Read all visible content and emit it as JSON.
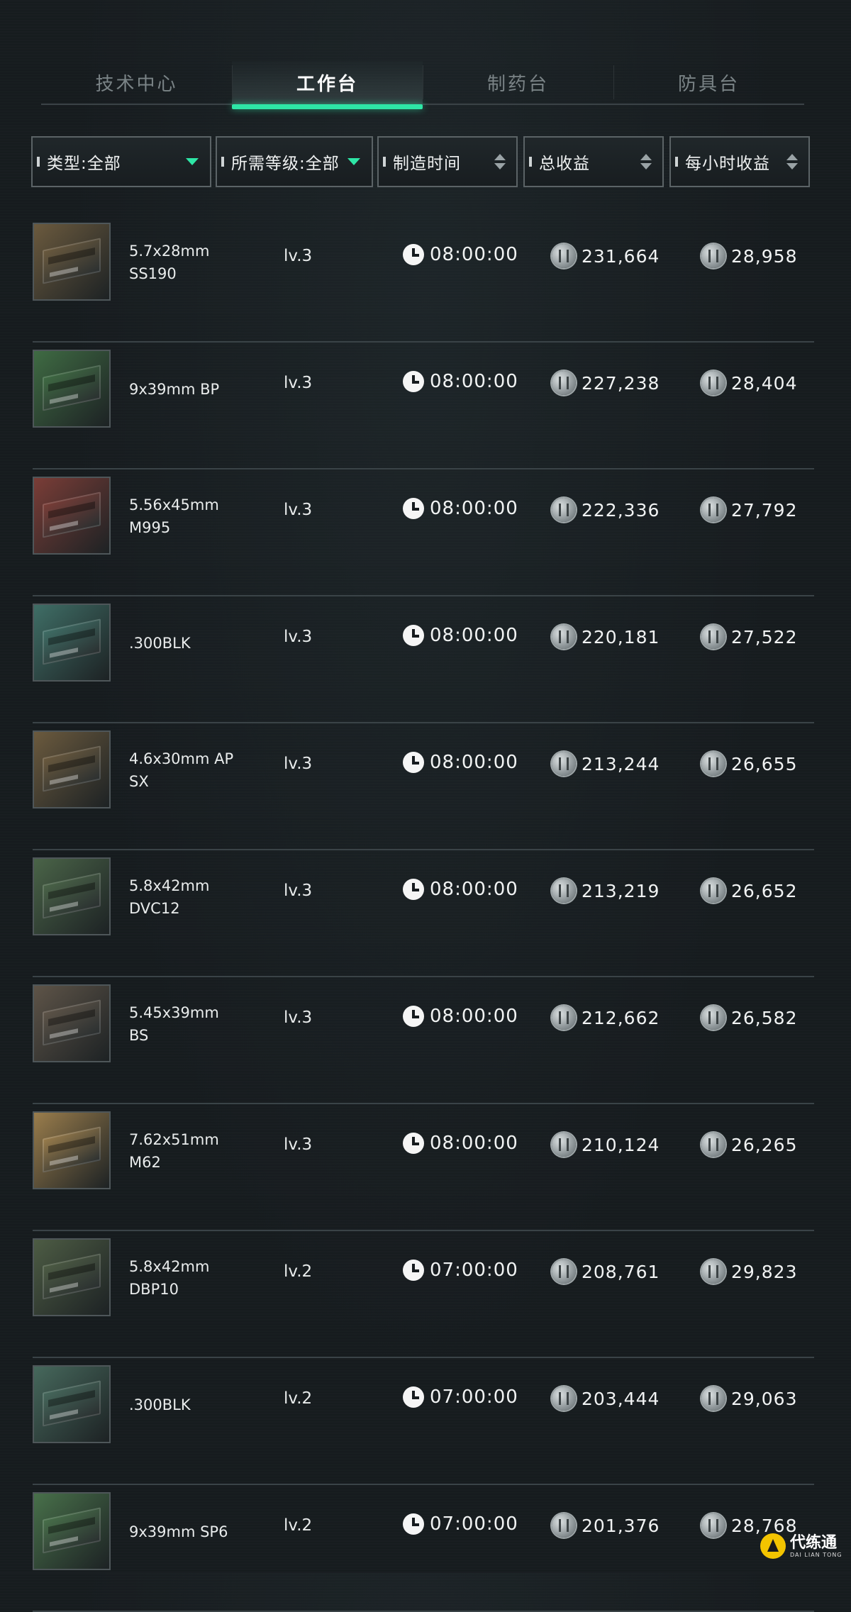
{
  "tabs": [
    {
      "label": "技术中心"
    },
    {
      "label": "工作台"
    },
    {
      "label": "制药台"
    },
    {
      "label": "防具台"
    }
  ],
  "filters": {
    "type": "类型:全部",
    "level": "所需等级:全部",
    "time": "制造时间",
    "total": "总收益",
    "hourly": "每小时收益"
  },
  "rows": [
    {
      "name1": "5.7x28mm",
      "name2": "SS190",
      "level": "lv.3",
      "time": "08:00:00",
      "total": "231,664",
      "hourly": "28,958",
      "color": "#6b5a3e"
    },
    {
      "name1": "9x39mm BP",
      "name2": "",
      "level": "lv.3",
      "time": "08:00:00",
      "total": "227,238",
      "hourly": "28,404",
      "color": "#3f6b43"
    },
    {
      "name1": "5.56x45mm",
      "name2": "M995",
      "level": "lv.3",
      "time": "08:00:00",
      "total": "222,336",
      "hourly": "27,792",
      "color": "#7a3d37"
    },
    {
      "name1": ".300BLK",
      "name2": "",
      "level": "lv.3",
      "time": "08:00:00",
      "total": "220,181",
      "hourly": "27,522",
      "color": "#3f6e66"
    },
    {
      "name1": "4.6x30mm AP",
      "name2": "SX",
      "level": "lv.3",
      "time": "08:00:00",
      "total": "213,244",
      "hourly": "26,655",
      "color": "#6b5a3e"
    },
    {
      "name1": "5.8x42mm",
      "name2": "DVC12",
      "level": "lv.3",
      "time": "08:00:00",
      "total": "213,219",
      "hourly": "26,652",
      "color": "#4a6448"
    },
    {
      "name1": "5.45x39mm",
      "name2": "BS",
      "level": "lv.3",
      "time": "08:00:00",
      "total": "212,662",
      "hourly": "26,582",
      "color": "#5e5448"
    },
    {
      "name1": "7.62x51mm",
      "name2": "M62",
      "level": "lv.3",
      "time": "08:00:00",
      "total": "210,124",
      "hourly": "26,265",
      "color": "#9a7d4c"
    },
    {
      "name1": "5.8x42mm",
      "name2": "DBP10",
      "level": "lv.2",
      "time": "07:00:00",
      "total": "208,761",
      "hourly": "29,823",
      "color": "#4d5c44"
    },
    {
      "name1": ".300BLK",
      "name2": "",
      "level": "lv.2",
      "time": "07:00:00",
      "total": "203,444",
      "hourly": "29,063",
      "color": "#46685c"
    },
    {
      "name1": "9x39mm SP6",
      "name2": "",
      "level": "lv.2",
      "time": "07:00:00",
      "total": "201,376",
      "hourly": "28,768",
      "color": "#48704a"
    }
  ],
  "watermark": {
    "cn": "代练通",
    "en": "DAI LIAN TONG"
  }
}
